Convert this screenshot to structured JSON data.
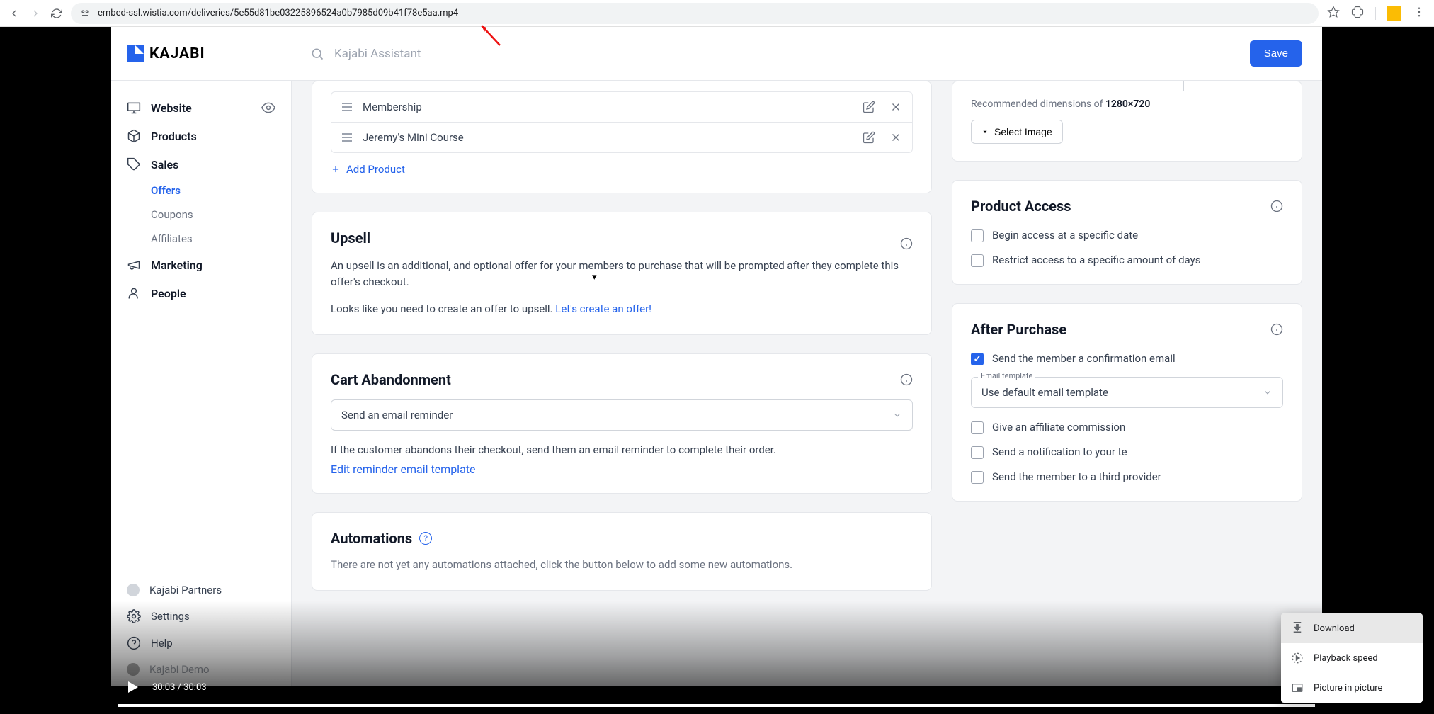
{
  "browser": {
    "url": "embed-ssl.wistia.com/deliveries/5e55d81be03225896524a0b7985d09b41f78e5aa.mp4"
  },
  "app": {
    "logo_text": "KAJABI",
    "search_placeholder": "Kajabi Assistant",
    "save_btn": "Save"
  },
  "sidebar": {
    "items": {
      "website": "Website",
      "products": "Products",
      "sales": "Sales",
      "marketing": "Marketing",
      "people": "People"
    },
    "sales_sub": {
      "offers": "Offers",
      "coupons": "Coupons",
      "affiliates": "Affiliates"
    },
    "footer": {
      "partners": "Kajabi Partners",
      "settings": "Settings",
      "help": "Help",
      "demo": "Kajabi Demo"
    }
  },
  "products_card": {
    "rows": [
      "Membership",
      "Jeremy's Mini Course"
    ],
    "add": "Add Product"
  },
  "upsell": {
    "title": "Upsell",
    "desc": "An upsell is an additional, and optional offer for your members to purchase that will be prompted after they complete this offer's checkout.",
    "prompt_prefix": "Looks like you need to create an offer to upsell. ",
    "prompt_link": "Let's create an offer!"
  },
  "cart": {
    "title": "Cart Abandonment",
    "select": "Send an email reminder",
    "desc": "If the customer abandons their checkout, send them an email reminder to complete their order.",
    "edit_link": "Edit reminder email template"
  },
  "automations": {
    "title": "Automations",
    "desc": "There are not yet any automations attached, click the button below to add some new automations."
  },
  "image_card": {
    "rec_prefix": "Recommended dimensions of ",
    "rec_dim": "1280×720",
    "select_btn": "Select Image"
  },
  "access": {
    "title": "Product Access",
    "begin": "Begin access at a specific date",
    "restrict": "Restrict access to a specific amount of days"
  },
  "after": {
    "title": "After Purchase",
    "confirm": "Send the member a confirmation email",
    "tpl_label": "Email template",
    "tpl_value": "Use default email template",
    "affiliate": "Give an affiliate commission",
    "notify": "Send a notification to your te",
    "third": "Send the member to a third provider"
  },
  "video": {
    "time": "30:03 / 30:03"
  },
  "context_menu": {
    "download": "Download",
    "speed": "Playback speed",
    "pip": "Picture in picture"
  }
}
